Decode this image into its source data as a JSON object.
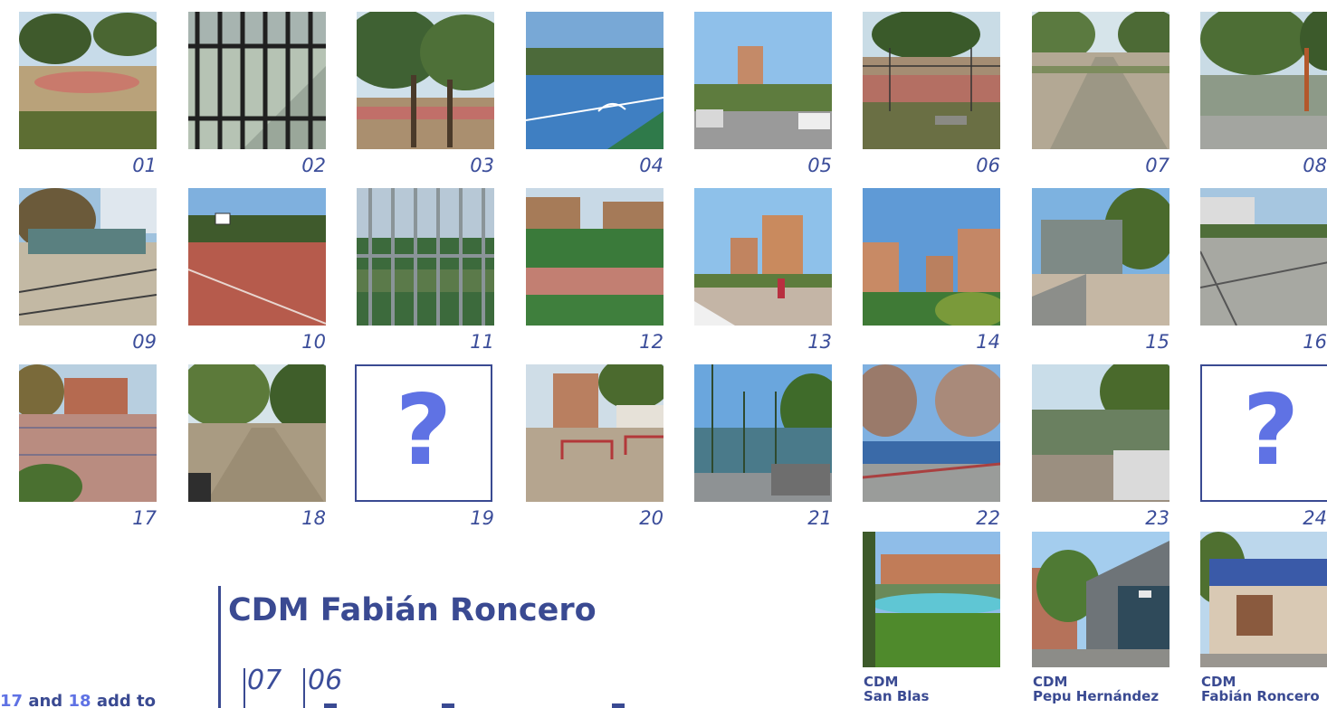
{
  "photos": {
    "numbers": [
      "01",
      "02",
      "03",
      "04",
      "05",
      "06",
      "07",
      "08",
      "09",
      "10",
      "11",
      "12",
      "13",
      "14",
      "15",
      "16",
      "17",
      "18",
      "19",
      "20",
      "21",
      "22",
      "23",
      "24"
    ],
    "unknown_mark": "?"
  },
  "facility": {
    "title": "CDM Fabián Roncero",
    "legend_numbers": [
      "07",
      "06"
    ]
  },
  "cdm_photos": [
    {
      "line1": "CDM",
      "line2": "San Blas"
    },
    {
      "line1": "CDM",
      "line2": "Pepu Hernández"
    },
    {
      "line1": "CDM",
      "line2": "Fabián Roncero"
    }
  ],
  "left_text": {
    "n1": "17",
    "w1": "and",
    "n2": "18",
    "w2": "add to"
  },
  "colors": {
    "accent": "#3a4a92",
    "question": "#5f72e4",
    "number": "#3b4d9a"
  }
}
